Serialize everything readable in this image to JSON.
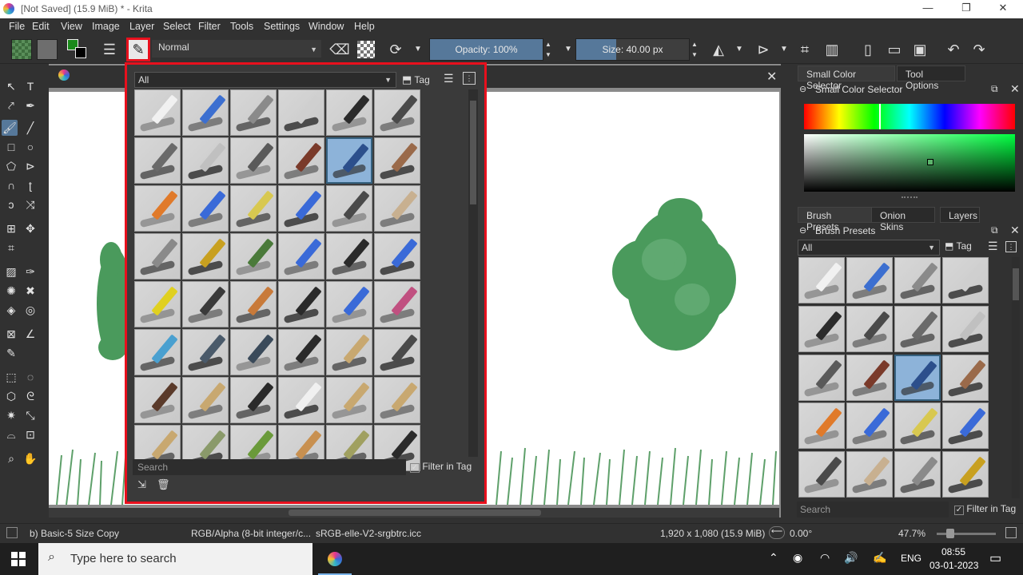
{
  "window": {
    "title": "[Not Saved]  (15.9 MiB)  * - Krita",
    "minimize": "—",
    "restore": "❐",
    "close": "✕"
  },
  "menu": [
    "File",
    "Edit",
    "View",
    "Image",
    "Layer",
    "Select",
    "Filter",
    "Tools",
    "Settings",
    "Window",
    "Help"
  ],
  "toolbar": {
    "blend_mode": "Normal",
    "opacity_label": "Opacity: 100%",
    "opacity_value": 1.0,
    "size_label": "Size: 40.00 px"
  },
  "popup": {
    "filter": "All",
    "tag_label": "Tag",
    "search_placeholder": "Search",
    "filter_in_tag": "Filter in Tag",
    "filter_check": "✓"
  },
  "dockers": {
    "tab_color": "Small Color Selector",
    "tab_tool_options": "Tool Options",
    "color_title": "Small Color Selector",
    "tab_brush_presets": "Brush Presets",
    "tab_onion": "Onion Skins",
    "tab_layers": "Layers",
    "brush_title": "Brush Presets",
    "brush_filter": "All",
    "tag_label": "Tag",
    "search_placeholder": "Search",
    "filter_in_tag": "Filter in Tag",
    "filter_check": "✓"
  },
  "status": {
    "preset": "b) Basic-5 Size Copy",
    "colorspace": "RGB/Alpha (8-bit integer/c...",
    "profile": "sRGB-elle-V2-srgbtrc.icc",
    "dimensions": "1,920 x 1,080 (15.9 MiB)",
    "rotation": "0.00°",
    "zoom": "47.7%"
  },
  "taskbar": {
    "search_placeholder": "Type here to search",
    "language": "ENG",
    "time": "08:55",
    "date": "03-01-2023"
  },
  "colors": {
    "accent": "#56789a",
    "highlight_border": "#e8101d",
    "foliage": "#4a9a5c"
  }
}
